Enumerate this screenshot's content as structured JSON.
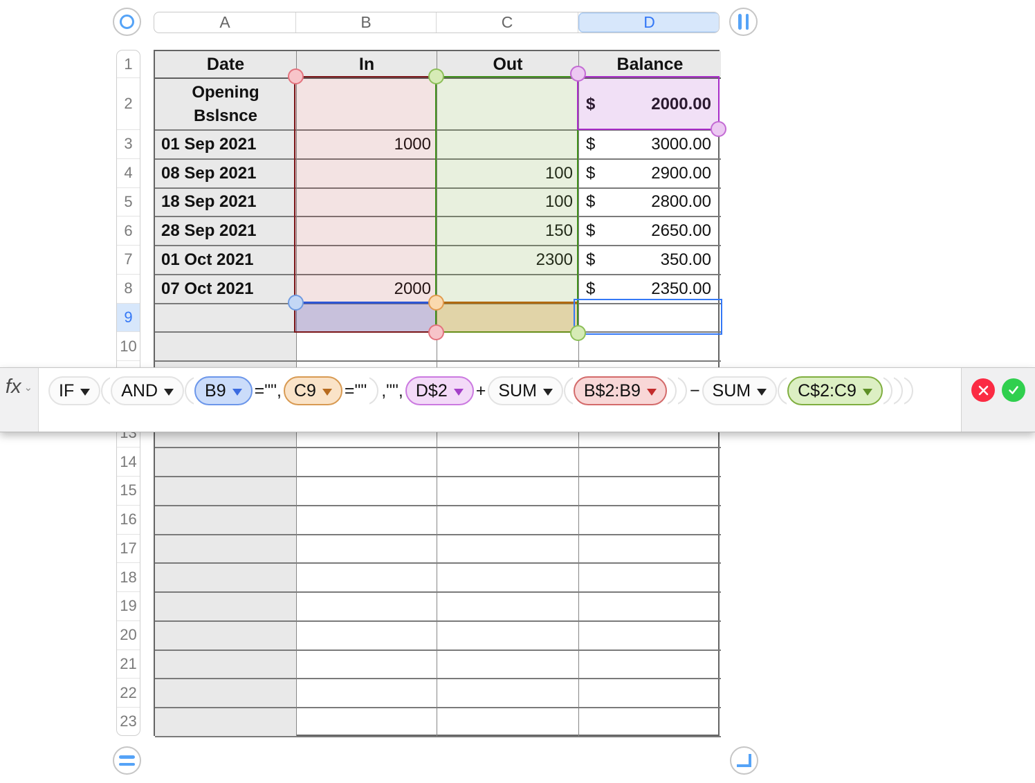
{
  "colors": {
    "accent": "#3478f6",
    "control-blue": "#55a3f7",
    "selected-bg": "#d7e7fb",
    "cell-gray": "#e9e9e9",
    "in-border": "#7b1518",
    "in-fill": "rgba(166,38,38,0.13)",
    "out-border": "#3f8f1a",
    "out-fill": "rgba(118,168,58,0.17)",
    "d2-border": "#a82cc8",
    "d2-fill": "rgba(170,70,200,0.17)",
    "b9-border": "#2d56d4",
    "b9-fill": "rgba(72,92,200,0.25)",
    "c9-border": "#b06a10",
    "c9-fill": "rgba(210,140,30,0.28)",
    "h-red-fill": "#f7c4c9",
    "h-red-border": "#e3737e",
    "h-green-fill": "#d6ebb6",
    "h-green-border": "#8cbf58",
    "h-purple-fill": "#ecc9f2",
    "h-purple-border": "#c36ad4",
    "h-blue-fill": "#c3d7f5",
    "h-blue-border": "#6f9ae0",
    "h-orange-fill": "#fad9ae",
    "h-orange-border": "#e29b4e",
    "pill-blue-bg": "#cbdcfa",
    "pill-blue-border": "#6b96ea",
    "pill-blue-arrow": "#3a6ae0",
    "pill-orange-bg": "#fae3c8",
    "pill-orange-border": "#d89a52",
    "pill-orange-arrow": "#b76a1d",
    "pill-purple-bg": "#f3daf8",
    "pill-purple-border": "#cb79e0",
    "pill-purple-arrow": "#a43fc8",
    "pill-red-bg": "#f8d7d7",
    "pill-red-border": "#d36a6a",
    "pill-red-arrow": "#c22b2b",
    "pill-green-bg": "#dcefc3",
    "pill-green-border": "#7fae3f",
    "pill-green-arrow": "#5d8f26",
    "cancel-red": "#fb2b43",
    "confirm-green": "#30cf4e"
  },
  "column_bar": {
    "letters": [
      "A",
      "B",
      "C",
      "D"
    ],
    "selected": "D"
  },
  "row_bar": {
    "count": 23,
    "selected": 9
  },
  "sheet": {
    "header": [
      "Date",
      "In",
      "Out",
      "Balance"
    ],
    "currency": "$",
    "rows": [
      {
        "n": 2,
        "date": "Opening\nBslsnce",
        "in": "",
        "out": "",
        "bal": "2000.00"
      },
      {
        "n": 3,
        "date": "01 Sep 2021",
        "in": "1000",
        "out": "",
        "bal": "3000.00"
      },
      {
        "n": 4,
        "date": "08 Sep 2021",
        "in": "",
        "out": "100",
        "bal": "2900.00"
      },
      {
        "n": 5,
        "date": "18 Sep 2021",
        "in": "",
        "out": "100",
        "bal": "2800.00"
      },
      {
        "n": 6,
        "date": "28 Sep 2021",
        "in": "",
        "out": "150",
        "bal": "2650.00"
      },
      {
        "n": 7,
        "date": "01 Oct 2021",
        "in": "",
        "out": "2300",
        "bal": "350.00"
      },
      {
        "n": 8,
        "date": "07 Oct 2021",
        "in": "2000",
        "out": "",
        "bal": "2350.00"
      }
    ]
  },
  "formula": {
    "fx_label": "fx",
    "tokens": [
      {
        "t": "func",
        "label": "IF"
      },
      {
        "t": "open"
      },
      {
        "t": "func",
        "label": "AND"
      },
      {
        "t": "open"
      },
      {
        "t": "ref",
        "label": "B9",
        "color": "blue"
      },
      {
        "t": "text",
        "label": "=\"\","
      },
      {
        "t": "ref",
        "label": "C9",
        "color": "orange"
      },
      {
        "t": "text",
        "label": "=\"\""
      },
      {
        "t": "close"
      },
      {
        "t": "text",
        "label": ",\"\","
      },
      {
        "t": "ref",
        "label": "D$2",
        "color": "purple"
      },
      {
        "t": "text",
        "label": "+"
      },
      {
        "t": "func",
        "label": "SUM"
      },
      {
        "t": "open"
      },
      {
        "t": "ref",
        "label": "B$2:B9",
        "color": "red"
      },
      {
        "t": "close"
      },
      {
        "t": "close"
      },
      {
        "t": "text",
        "label": "−"
      },
      {
        "t": "func",
        "label": "SUM"
      },
      {
        "t": "open"
      },
      {
        "t": "ref",
        "label": "C$2:C9",
        "color": "green"
      },
      {
        "t": "close"
      },
      {
        "t": "close"
      },
      {
        "t": "close"
      }
    ]
  }
}
